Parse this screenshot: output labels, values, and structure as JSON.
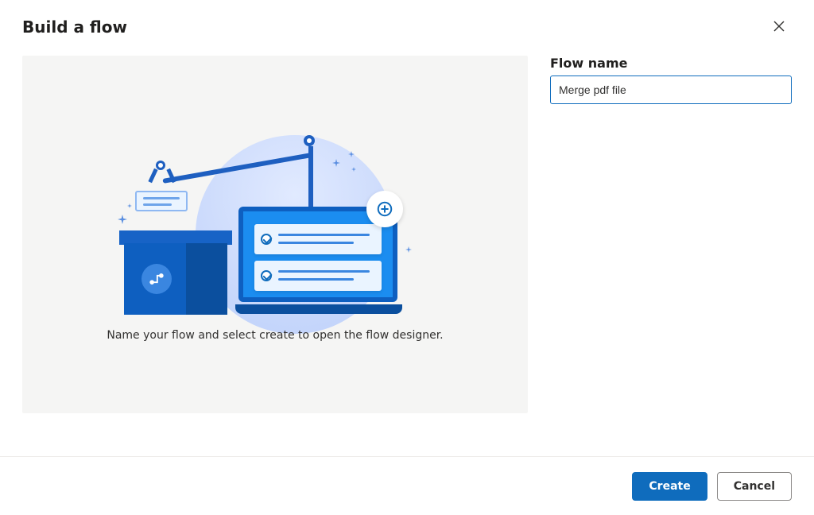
{
  "dialog": {
    "title": "Build a flow",
    "caption": "Name your flow and select create to open the flow designer."
  },
  "form": {
    "flow_name_label": "Flow name",
    "flow_name_value": "Merge pdf file"
  },
  "footer": {
    "create_label": "Create",
    "cancel_label": "Cancel"
  }
}
